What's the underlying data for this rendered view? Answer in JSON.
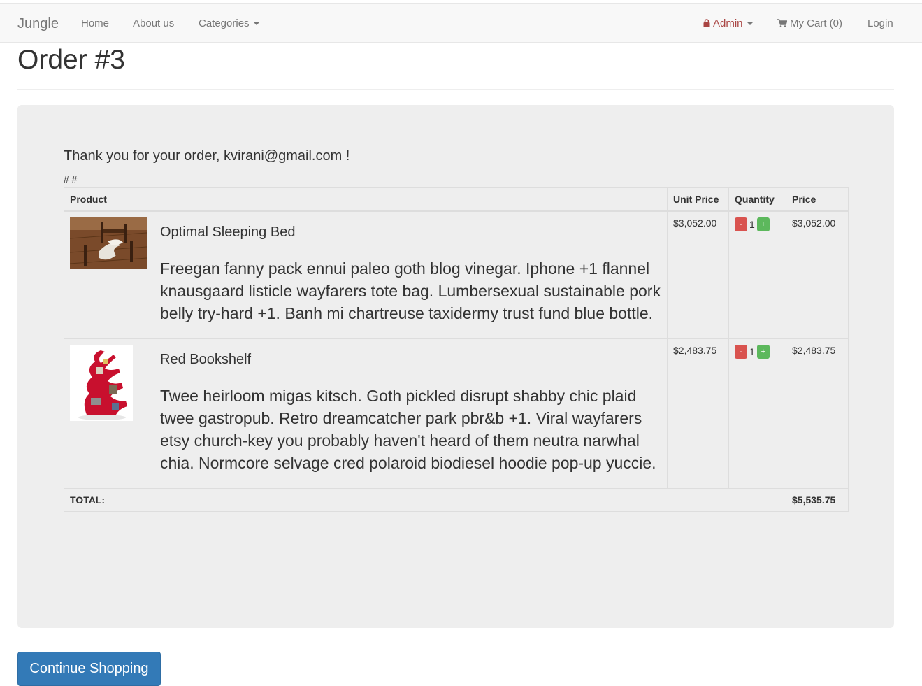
{
  "navbar": {
    "brand": "Jungle",
    "home": "Home",
    "about": "About us",
    "categories": "Categories",
    "admin": "Admin",
    "cart": "My Cart (0)",
    "login": "Login"
  },
  "page": {
    "title": "Order #3",
    "thanks": "Thank you for your order, kvirani@gmail.com !",
    "hashes": "# #"
  },
  "table": {
    "headers": {
      "product": "Product",
      "unit_price": "Unit Price",
      "quantity": "Quantity",
      "price": "Price"
    },
    "items": [
      {
        "name": "Optimal Sleeping Bed",
        "description": "Freegan fanny pack ennui paleo goth blog vinegar. Iphone +1 flannel knausgaard listicle wayfarers tote bag. Lumbersexual sustainable pork belly try-hard +1. Banh mi chartreuse taxidermy trust fund blue bottle.",
        "unit_price": "$3,052.00",
        "minus": "-",
        "quantity": "1",
        "plus": "+",
        "price": "$3,052.00"
      },
      {
        "name": "Red Bookshelf",
        "description": "Twee heirloom migas kitsch. Goth pickled disrupt shabby chic plaid twee gastropub. Retro dreamcatcher park pbr&b +1. Viral wayfarers etsy church-key you probably haven't heard of them neutra narwhal chia. Normcore selvage cred polaroid biodiesel hoodie pop-up yuccie.",
        "unit_price": "$2,483.75",
        "minus": "-",
        "quantity": "1",
        "plus": "+",
        "price": "$2,483.75"
      }
    ],
    "total_label": "TOTAL:",
    "total_value": "$5,535.75"
  },
  "actions": {
    "continue": "Continue Shopping"
  },
  "colors": {
    "primary": "#337ab7",
    "danger": "#d9534f",
    "success": "#5cb85c",
    "admin": "#a94442"
  }
}
